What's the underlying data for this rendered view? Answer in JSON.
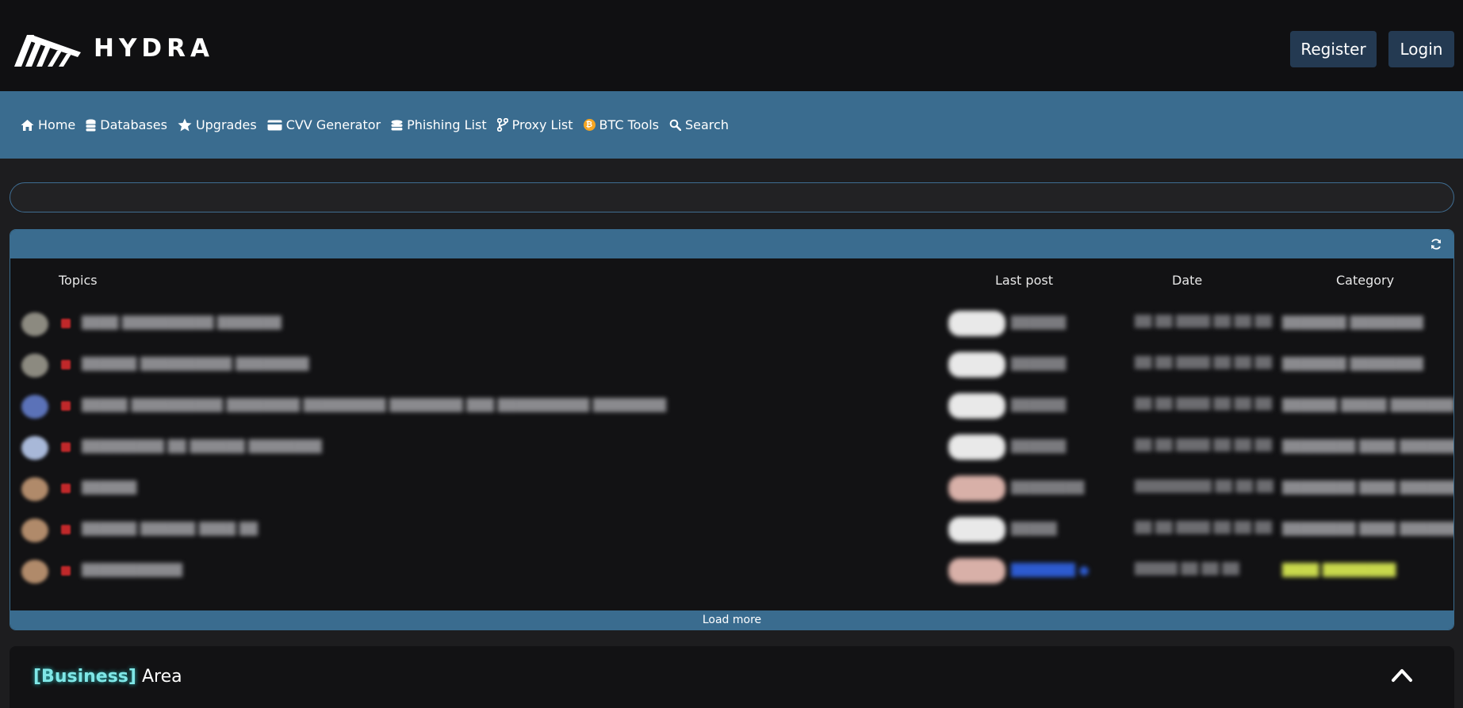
{
  "header": {
    "logo_text": "HYDRA",
    "register_label": "Register",
    "login_label": "Login"
  },
  "nav": {
    "items": [
      {
        "label": "Home",
        "icon": "home-icon"
      },
      {
        "label": "Databases",
        "icon": "database-icon"
      },
      {
        "label": "Upgrades",
        "icon": "star-icon"
      },
      {
        "label": "CVV Generator",
        "icon": "credit-card-icon"
      },
      {
        "label": "Phishing List",
        "icon": "database-icon"
      },
      {
        "label": "Proxy List",
        "icon": "branch-icon"
      },
      {
        "label": "BTC Tools",
        "icon": "bitcoin-icon"
      },
      {
        "label": "Search",
        "icon": "search-icon"
      }
    ]
  },
  "search": {
    "placeholder": ""
  },
  "topics": {
    "columns": {
      "topics": "Topics",
      "last_post": "Last post",
      "date": "Date",
      "category": "Category"
    },
    "load_more_label": "Load more"
  },
  "business": {
    "tag": "[Business]",
    "title": "Area"
  },
  "colors": {
    "background": "#1d1d1f",
    "header": "#101012",
    "nav": "#3a6c8f",
    "button": "#243a52",
    "panel": "#121214",
    "accent_cyan": "#7fe7e7"
  }
}
